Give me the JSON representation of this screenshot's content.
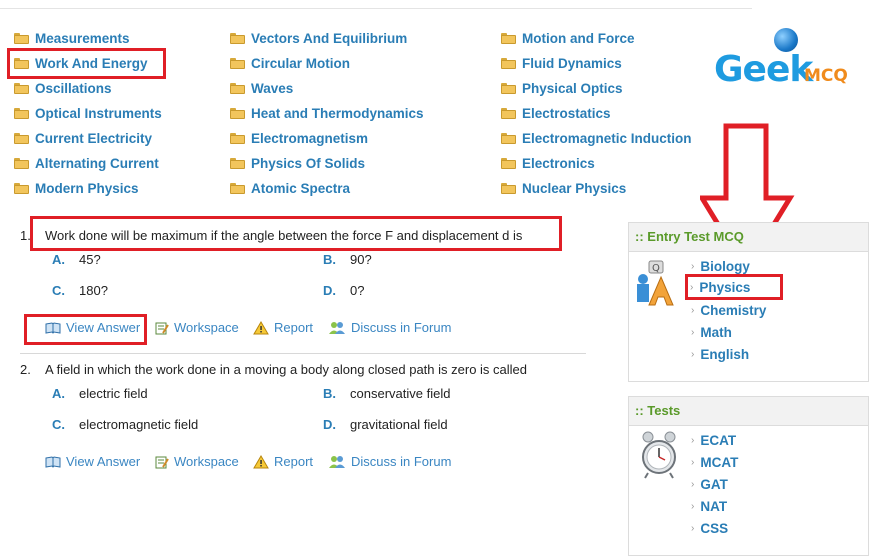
{
  "topics": [
    [
      "Measurements",
      "Vectors And Equilibrium",
      "Motion and Force"
    ],
    [
      "Work And Energy",
      "Circular Motion",
      "Fluid Dynamics"
    ],
    [
      "Oscillations",
      "Waves",
      "Physical Optics"
    ],
    [
      "Optical Instruments",
      "Heat and Thermodynamics",
      "Electrostatics"
    ],
    [
      "Current Electricity",
      "Electromagnetism",
      "Electromagnetic Induction"
    ],
    [
      "Alternating Current",
      "Physics Of Solids",
      "Electronics"
    ],
    [
      "Modern Physics",
      "Atomic Spectra",
      "Nuclear Physics"
    ]
  ],
  "logo": {
    "geek": "Geek",
    "mcq": "MCQ"
  },
  "questions": [
    {
      "number": "1.",
      "text": "Work done will be maximum if the angle between the force F and displacement d is",
      "options": [
        {
          "letter": "A.",
          "text": "45?"
        },
        {
          "letter": "B.",
          "text": "90?"
        },
        {
          "letter": "C.",
          "text": "180?"
        },
        {
          "letter": "D.",
          "text": "0?"
        }
      ]
    },
    {
      "number": "2.",
      "text": "A field in which the work done in a moving a body along closed path is zero is called",
      "options": [
        {
          "letter": "A.",
          "text": "electric field"
        },
        {
          "letter": "B.",
          "text": "conservative field"
        },
        {
          "letter": "C.",
          "text": "electromagnetic field"
        },
        {
          "letter": "D.",
          "text": "gravitational field"
        }
      ]
    }
  ],
  "actions": {
    "view_answer": "View Answer",
    "workspace": "Workspace",
    "report": "Report",
    "forum": "Discuss in Forum"
  },
  "sidebar": {
    "entry_test": {
      "title": ":: Entry Test MCQ",
      "items": [
        "Biology",
        "Physics",
        "Chemistry",
        "Math",
        "English"
      ]
    },
    "tests": {
      "title": ":: Tests",
      "items": [
        "ECAT",
        "MCAT",
        "GAT",
        "NAT",
        "CSS"
      ]
    }
  },
  "colors": {
    "link": "#2a7db5",
    "annotation": "#e01f26",
    "panel_heading": "#5a9a2a",
    "logo_blue": "#1e9be0",
    "logo_orange": "#f08b1c"
  }
}
